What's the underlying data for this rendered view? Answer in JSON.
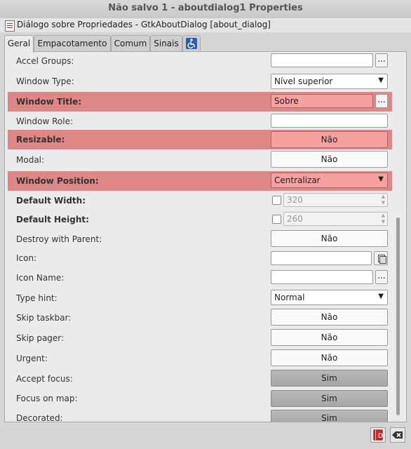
{
  "window": {
    "title": "Não salvo 1 - aboutdialog1 Properties"
  },
  "header": {
    "text": "Diálogo sobre Propriedades - GtkAboutDialog [about_dialog]"
  },
  "tabs": [
    {
      "label": "Geral"
    },
    {
      "label": "Empacotamento"
    },
    {
      "label": "Comum"
    },
    {
      "label": "Sinais"
    }
  ],
  "accessibility_tab_icon": "wheelchair-icon",
  "properties": {
    "accel_groups": {
      "label": "Accel Groups:",
      "value": "",
      "button": "..."
    },
    "window_type": {
      "label": "Window Type:",
      "value": "Nível superior"
    },
    "window_title": {
      "label": "Window Title:",
      "value": "Sobre",
      "button": "..."
    },
    "window_role": {
      "label": "Window Role:",
      "value": ""
    },
    "resizable": {
      "label": "Resizable:",
      "value": "Não"
    },
    "modal": {
      "label": "Modal:",
      "value": "Não"
    },
    "window_position": {
      "label": "Window Position:",
      "value": "Centralizar"
    },
    "default_width": {
      "label": "Default Width:",
      "value": "320"
    },
    "default_height": {
      "label": "Default Height:",
      "value": "260"
    },
    "destroy_with_parent": {
      "label": "Destroy with Parent:",
      "value": "Não"
    },
    "icon": {
      "label": "Icon:",
      "value": ""
    },
    "icon_name": {
      "label": "Icon Name:",
      "value": "",
      "button": "..."
    },
    "type_hint": {
      "label": "Type hint:",
      "value": "Normal"
    },
    "skip_taskbar": {
      "label": "Skip taskbar:",
      "value": "Não"
    },
    "skip_pager": {
      "label": "Skip pager:",
      "value": "Não"
    },
    "urgent": {
      "label": "Urgent:",
      "value": "Não"
    },
    "accept_focus": {
      "label": "Accept focus:",
      "value": "Sim"
    },
    "focus_on_map": {
      "label": "Focus on map:",
      "value": "Sim"
    },
    "decorated": {
      "label": "Decorated:",
      "value": "Sim"
    }
  },
  "glyphs": {
    "dropdown_arrow": "▼",
    "spin_up": "▲",
    "spin_down": "▼"
  },
  "colors": {
    "highlight_row": "#df8686",
    "modified_field": "#f6a0a0",
    "window_bg": "#d6d6d6"
  }
}
